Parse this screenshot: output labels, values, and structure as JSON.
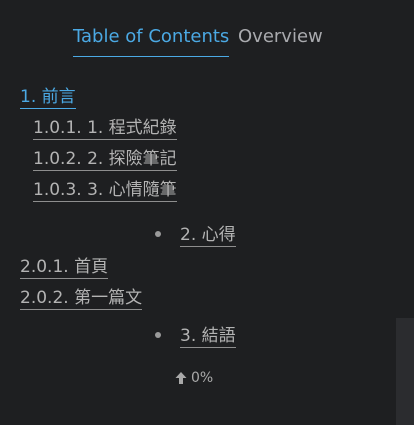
{
  "tabs": {
    "table_of_contents": "Table of Contents",
    "overview": "Overview"
  },
  "toc": {
    "items": [
      {
        "label": "1. 前言"
      },
      {
        "label": "1.0.1. 1. 程式紀錄"
      },
      {
        "label": "1.0.2. 2. 探險筆記"
      },
      {
        "label": "1.0.3. 3. 心情隨筆"
      },
      {
        "label": "2. 心得"
      },
      {
        "label": "2.0.1. 首頁"
      },
      {
        "label": "2.0.2. 第一篇文"
      },
      {
        "label": "3. 結語"
      }
    ]
  },
  "progress": {
    "value": "0%",
    "icon": "arrow-up-icon"
  },
  "colors": {
    "background": "#1e1f21",
    "accent": "#4ba9e4",
    "text": "#b3b3b3"
  }
}
